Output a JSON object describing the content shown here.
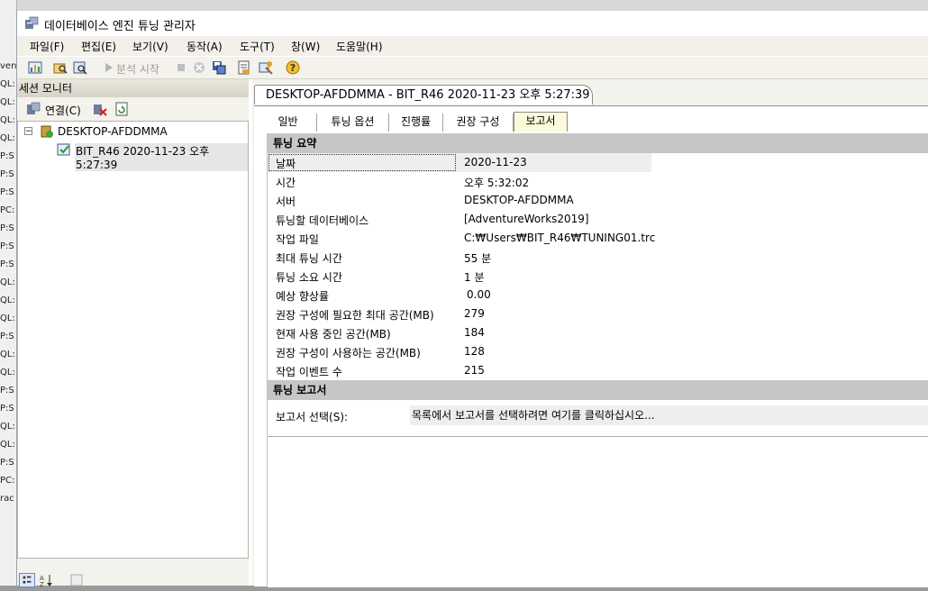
{
  "window": {
    "title": "데이터베이스 엔진 튜닝 관리자"
  },
  "menu": [
    "파일(F)",
    "편집(E)",
    "보기(V)",
    "동작(A)",
    "도구(T)",
    "창(W)",
    "도움말(H)"
  ],
  "toolbar": {
    "start_analysis_label": "분석 시작"
  },
  "background_strip": [
    "ven",
    "QL:",
    "QL:",
    "QL:",
    "QL:",
    "P:S",
    "P:S",
    "P:S",
    "PC:",
    "P:S",
    "P:S",
    "P:S",
    "QL:",
    "QL:",
    "QL:",
    "P:S",
    "QL:",
    "QL:",
    "P:S",
    "P:S",
    "QL:",
    "QL:",
    "P:S",
    "PC:",
    "rac"
  ],
  "session_monitor": {
    "title": "세션 모니터",
    "connect_label": "연결(C)",
    "tree": {
      "server": "DESKTOP-AFDDMMA",
      "session": "BIT_R46 2020-11-23 오후 5:27:39"
    }
  },
  "document": {
    "tab_title": "DESKTOP-AFDDMMA - BIT_R46 2020-11-23 오후 5:27:39",
    "subtabs": [
      "일반",
      "튜닝 옵션",
      "진행률",
      "권장 구성",
      "보고서"
    ],
    "active_subtab": "보고서",
    "summary": {
      "header": "튜닝 요약",
      "rows": [
        {
          "label": "날짜",
          "value": "2020-11-23"
        },
        {
          "label": "시간",
          "value": "오후 5:32:02"
        },
        {
          "label": "서버",
          "value": "DESKTOP-AFDDMMA"
        },
        {
          "label": "튜닝할 데이터베이스",
          "value": "[AdventureWorks2019]"
        },
        {
          "label": "작업 파일",
          "value": "C:₩Users₩BIT_R46₩TUNING01.trc"
        },
        {
          "label": "최대 튜닝 시간",
          "value": "55 분"
        },
        {
          "label": "튜닝 소요 시간",
          "value": "1 분"
        },
        {
          "label": "예상 향상률",
          "value": "0.00"
        },
        {
          "label": "권장 구성에 필요한 최대 공간(MB)",
          "value": "279"
        },
        {
          "label": "현재 사용 중인 공간(MB)",
          "value": "184"
        },
        {
          "label": "권장 구성이 사용하는 공간(MB)",
          "value": "128"
        },
        {
          "label": "작업 이벤트 수",
          "value": "215"
        }
      ]
    },
    "report": {
      "header": "튜닝 보고서",
      "select_label": "보고서 선택(S):",
      "select_placeholder": "목록에서 보고서를 선택하려면 여기를 클릭하십시오..."
    }
  },
  "colors": {
    "section_header": "#c6c6c6",
    "active_tab": "#fbfbdb",
    "panel": "#f4f2ec"
  }
}
